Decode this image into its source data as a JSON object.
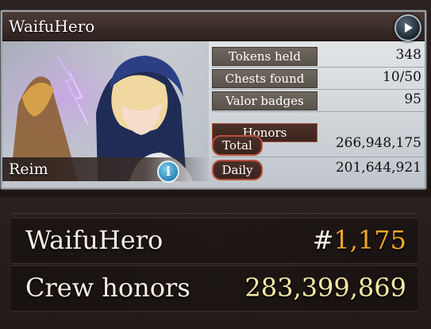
{
  "header": {
    "player_name": "WaifuHero"
  },
  "character": {
    "name": "Reim"
  },
  "stats": [
    {
      "label": "Tokens held",
      "value": "348"
    },
    {
      "label": "Chests found",
      "value": "10/50"
    },
    {
      "label": "Valor badges",
      "value": "95"
    }
  ],
  "honors": {
    "title": "Honors",
    "total_label": "Total",
    "total_value": "266,948,175",
    "daily_label": "Daily",
    "daily_value": "201,644,921"
  },
  "ranking": {
    "player_name": "WaifuHero",
    "rank_prefix": "#",
    "rank": "1,175",
    "crew_label": "Crew honors",
    "crew_value": "283,399,869"
  },
  "colors": {
    "rank_accent": "#f2a629",
    "crew_value": "#f6e9a8",
    "pill_border": "#b8503e"
  },
  "icons": [
    "play-icon",
    "info-icon"
  ]
}
